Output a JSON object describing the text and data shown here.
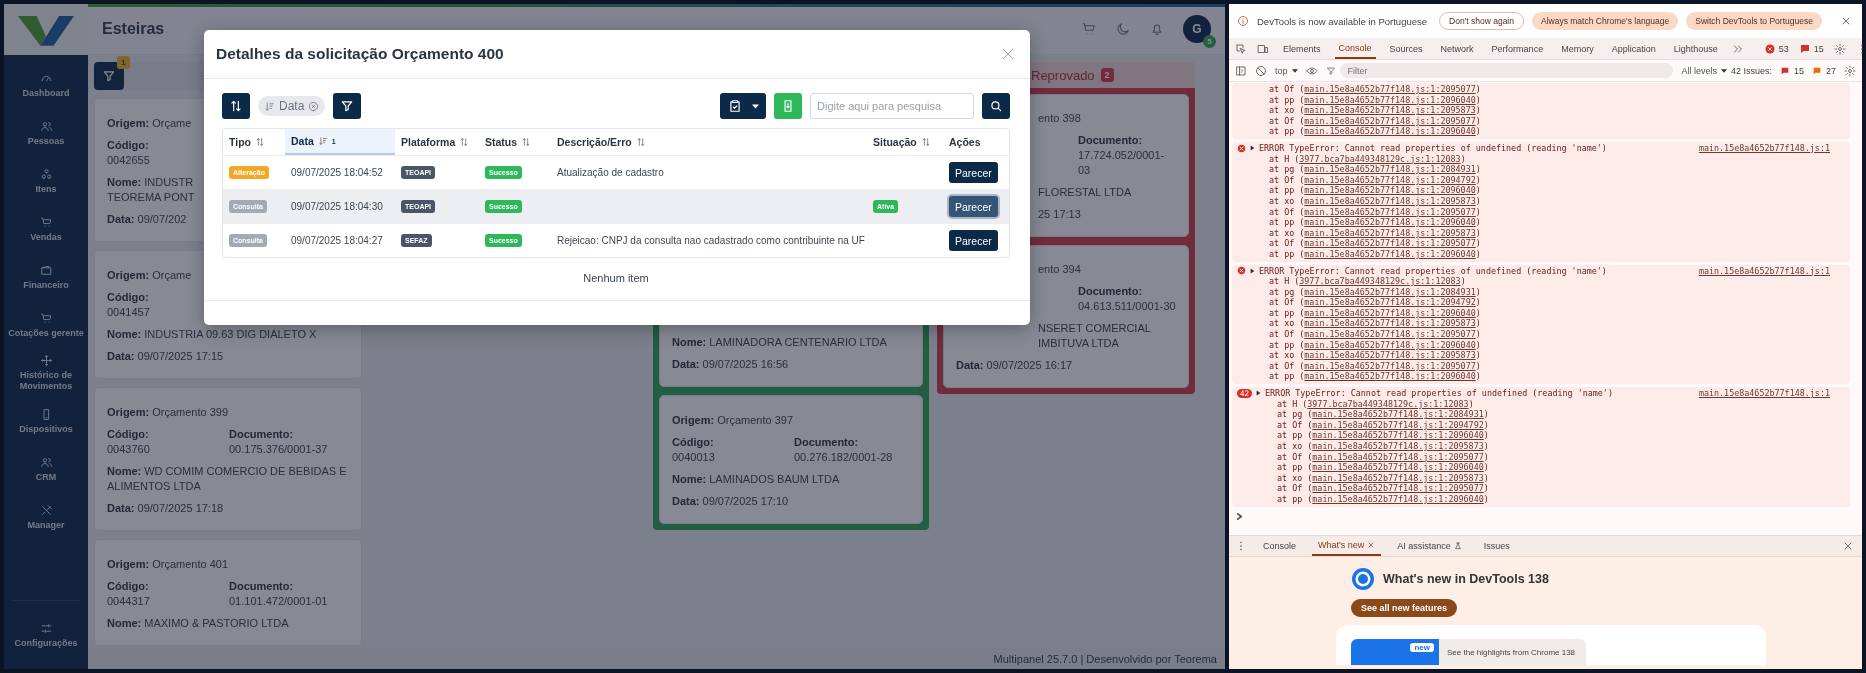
{
  "app": {
    "header": {
      "title": "Esteiras",
      "avatar_initial": "G",
      "avatar_badge": "5"
    },
    "sidebar": {
      "items": [
        {
          "label": "Dashboard",
          "kind": "gauge"
        },
        {
          "label": "Pessoas",
          "kind": "people"
        },
        {
          "label": "Itens",
          "kind": "circles"
        },
        {
          "label": "Vendas",
          "kind": "cart"
        },
        {
          "label": "Financeiro",
          "kind": "wallet"
        },
        {
          "label": "Cotações gerente",
          "kind": "cart"
        },
        {
          "label": "Histórico de Movimentos",
          "kind": "move"
        },
        {
          "label": "Dispositivos",
          "kind": "phone"
        },
        {
          "label": "CRM",
          "kind": "people"
        },
        {
          "label": "Manager",
          "kind": "tools"
        }
      ],
      "footer_item": {
        "label": "Configurações",
        "kind": "sliders"
      }
    },
    "board": {
      "filter_badge": "1",
      "first_column_cards": [
        {
          "origem": {
            "label": "Origem:",
            "value": "Orçame"
          },
          "codigo": {
            "label": "Código:",
            "value": "0042655"
          },
          "nome": {
            "label": "Nome:",
            "value": "INDUSTR\nTEOREMA PONT"
          },
          "data": {
            "label": "Data:",
            "value": "09/07/202"
          }
        },
        {
          "origem": {
            "label": "Origem:",
            "value": "Orçame"
          },
          "codigo": {
            "label": "Código:",
            "value": "0041457"
          },
          "nome": {
            "label": "Nome:",
            "value": "INDUSTRIA 09.63 DIG DIALETO X"
          },
          "data": {
            "label": "Data:",
            "value": "09/07/2025 17:15"
          }
        },
        {
          "origem": {
            "label": "Origem:",
            "value": "Orçamento 399"
          },
          "codigo": {
            "label": "Código:",
            "value": "0043760"
          },
          "documento": {
            "label": "Documento:",
            "value": "00.175.376/0001-37"
          },
          "nome": {
            "label": "Nome:",
            "value": "WD COMIM COMERCIO DE BEBIDAS E ALIMENTOS LTDA"
          },
          "data": {
            "label": "Data:",
            "value": "09/07/2025 17:18"
          }
        },
        {
          "origem": {
            "label": "Origem:",
            "value": "Orçamento 401"
          },
          "codigo": {
            "label": "Código:",
            "value": "0044317"
          },
          "documento": {
            "label": "Documento:",
            "value": "01.101.472/0001-01"
          },
          "nome": {
            "label": "Nome:",
            "value": "MAXIMO & PASTORIO LTDA"
          }
        }
      ],
      "approved_cards": [
        {
          "nome": {
            "label": "Nome:",
            "value": "LAMINADORA CENTENARIO LTDA"
          },
          "data": {
            "label": "Data:",
            "value": "09/07/2025 16:56"
          }
        },
        {
          "origem": {
            "label": "Origem:",
            "value": "Orçamento 397"
          },
          "codigo": {
            "label": "Código:",
            "value": "0040013"
          },
          "documento": {
            "label": "Documento:",
            "value": "00.276.182/0001-28"
          },
          "nome": {
            "label": "Nome:",
            "value": "LAMINADOS BAUM LTDA"
          },
          "data": {
            "label": "Data:",
            "value": "09/07/2025 17:10"
          }
        }
      ],
      "rejected": {
        "title": "Reprovado",
        "count": "2",
        "cards": [
          {
            "origem": {
              "value": "ento 398"
            },
            "documento": {
              "label": "Documento:",
              "value": "17.724.052/0001-03"
            },
            "nome": {
              "value": "FLORESTAL LTDA"
            },
            "data": {
              "value": "25 17:13"
            }
          },
          {
            "origem": {
              "value": "ento 394"
            },
            "documento": {
              "label": "Documento:",
              "value": "04.613.511/0001-30"
            },
            "nome": {
              "value": "NSERET COMERCIAL\nIMBITUVA LTDA"
            },
            "data": {
              "label": "Data:",
              "value": "09/07/2025 16:17"
            }
          }
        ]
      }
    },
    "footer": "Multipanel 25.7.0 | Desenvolvido por Teorema"
  },
  "modal": {
    "title": "Detalhes da solicitação Orçamento 400",
    "sort_chip": "Data",
    "search": {
      "placeholder": "Digite aqui para pesquisa"
    },
    "table": {
      "columns": [
        {
          "label": "Tipo",
          "sortable": true,
          "sorted": false
        },
        {
          "label": "Data",
          "sortable": true,
          "sorted": true,
          "sort_index": "1"
        },
        {
          "label": "Plataforma",
          "sortable": true,
          "sorted": false
        },
        {
          "label": "Status",
          "sortable": true,
          "sorted": false
        },
        {
          "label": "Descrição/Erro",
          "sortable": true,
          "sorted": false
        },
        {
          "label": "Situação",
          "sortable": true,
          "sorted": false
        },
        {
          "label": "Ações",
          "sortable": false,
          "sorted": false
        }
      ],
      "rows": [
        {
          "tipo": "Alteração",
          "color": "#f5a623",
          "data": "09/07/2025 18:04:52",
          "plataforma": "TEOAPI",
          "status": "Sucesso",
          "descricao": "Atualização de cadastro",
          "action": "Parecer",
          "selected": false
        },
        {
          "tipo": "Consulta",
          "color": "#a3aab6",
          "data": "09/07/2025 18:04:30",
          "plataforma": "TEOAPI",
          "status": "Sucesso",
          "situacao": "Ativa",
          "action": "Parecer",
          "selected": true
        },
        {
          "tipo": "Consulta",
          "color": "#a3aab6",
          "data": "09/07/2025 18:04:27",
          "plataforma": "SEFAZ",
          "status": "Sucesso",
          "descricao": "Rejeicao: CNPJ da consulta nao cadastrado como contribuinte na UF",
          "action": "Parecer",
          "selected": false
        }
      ],
      "empty_text": "Nenhum item"
    }
  },
  "devtools": {
    "infobar": {
      "message": "DevTools is now available in Portuguese",
      "buttons": [
        {
          "label": "Don't show again",
          "kind": "outline"
        },
        {
          "label": "Always match Chrome's language",
          "kind": "filled"
        },
        {
          "label": "Switch DevTools to Portuguese",
          "kind": "filled"
        }
      ]
    },
    "tabs": [
      {
        "label": "Elements",
        "selected": false
      },
      {
        "label": "Console",
        "selected": true
      },
      {
        "label": "Sources",
        "selected": false
      },
      {
        "label": "Network",
        "selected": false
      },
      {
        "label": "Performance",
        "selected": false
      },
      {
        "label": "Memory",
        "selected": false
      },
      {
        "label": "Application",
        "selected": false
      },
      {
        "label": "Lighthouse",
        "selected": false
      }
    ],
    "error_count": "53",
    "issue_count": "15",
    "console_toolbar": {
      "context": "top",
      "filter_placeholder": "Filter",
      "levels": "All levels",
      "issues_label": "42 Issues:",
      "issues_errors": "15",
      "issues_warnings": "27"
    },
    "messages": [
      {
        "kind": "continuation",
        "frames": [
          {
            "call": "at Of (",
            "link": "main.15e8a4652b77f148.js:1:2095077",
            "close": ")"
          },
          {
            "call": "at pp (",
            "link": "main.15e8a4652b77f148.js:1:2096040",
            "close": ")"
          },
          {
            "call": "at xo (",
            "link": "main.15e8a4652b77f148.js:1:2095873",
            "close": ")"
          },
          {
            "call": "at Of (",
            "link": "main.15e8a4652b77f148.js:1:2095077",
            "close": ")"
          },
          {
            "call": "at pp (",
            "link": "main.15e8a4652b77f148.js:1:2096040",
            "close": ")"
          }
        ]
      },
      {
        "kind": "error",
        "text": "ERROR TypeError: Cannot read properties of undefined (reading 'name')",
        "source": "main.15e8a4652b77f148.js:1",
        "frames": [
          {
            "call": "at H (",
            "link": "3977.bca7ba449348129c.js:1:12083",
            "close": ")"
          },
          {
            "call": "at pg (",
            "link": "main.15e8a4652b77f148.js:1:2084931",
            "close": ")"
          },
          {
            "call": "at Of (",
            "link": "main.15e8a4652b77f148.js:1:2094792",
            "close": ")"
          },
          {
            "call": "at pp (",
            "link": "main.15e8a4652b77f148.js:1:2096040",
            "close": ")"
          },
          {
            "call": "at xo (",
            "link": "main.15e8a4652b77f148.js:1:2095873",
            "close": ")"
          },
          {
            "call": "at Of (",
            "link": "main.15e8a4652b77f148.js:1:2095077",
            "close": ")"
          },
          {
            "call": "at pp (",
            "link": "main.15e8a4652b77f148.js:1:2096040",
            "close": ")"
          },
          {
            "call": "at xo (",
            "link": "main.15e8a4652b77f148.js:1:2095873",
            "close": ")"
          },
          {
            "call": "at Of (",
            "link": "main.15e8a4652b77f148.js:1:2095077",
            "close": ")"
          },
          {
            "call": "at pp (",
            "link": "main.15e8a4652b77f148.js:1:2096040",
            "close": ")"
          }
        ]
      },
      {
        "kind": "error",
        "text": "ERROR TypeError: Cannot read properties of undefined (reading 'name')",
        "source": "main.15e8a4652b77f148.js:1",
        "frames": [
          {
            "call": "at H (",
            "link": "3977.bca7ba449348129c.js:1:12083",
            "close": ")"
          },
          {
            "call": "at pg (",
            "link": "main.15e8a4652b77f148.js:1:2084931",
            "close": ")"
          },
          {
            "call": "at Of (",
            "link": "main.15e8a4652b77f148.js:1:2094792",
            "close": ")"
          },
          {
            "call": "at pp (",
            "link": "main.15e8a4652b77f148.js:1:2096040",
            "close": ")"
          },
          {
            "call": "at xo (",
            "link": "main.15e8a4652b77f148.js:1:2095873",
            "close": ")"
          },
          {
            "call": "at Of (",
            "link": "main.15e8a4652b77f148.js:1:2095077",
            "close": ")"
          },
          {
            "call": "at pp (",
            "link": "main.15e8a4652b77f148.js:1:2096040",
            "close": ")"
          },
          {
            "call": "at xo (",
            "link": "main.15e8a4652b77f148.js:1:2095873",
            "close": ")"
          },
          {
            "call": "at Of (",
            "link": "main.15e8a4652b77f148.js:1:2095077",
            "close": ")"
          },
          {
            "call": "at pp (",
            "link": "main.15e8a4652b77f148.js:1:2096040",
            "close": ")"
          }
        ]
      },
      {
        "kind": "error",
        "count": "42",
        "text": "ERROR TypeError: Cannot read properties of undefined (reading 'name')",
        "source": "main.15e8a4652b77f148.js:1",
        "frames": [
          {
            "call": "at H (",
            "link": "3977.bca7ba449348129c.js:1:12083",
            "close": ")"
          },
          {
            "call": "at pg (",
            "link": "main.15e8a4652b77f148.js:1:2084931",
            "close": ")"
          },
          {
            "call": "at Of (",
            "link": "main.15e8a4652b77f148.js:1:2094792",
            "close": ")"
          },
          {
            "call": "at pp (",
            "link": "main.15e8a4652b77f148.js:1:2096040",
            "close": ")"
          },
          {
            "call": "at xo (",
            "link": "main.15e8a4652b77f148.js:1:2095873",
            "close": ")"
          },
          {
            "call": "at Of (",
            "link": "main.15e8a4652b77f148.js:1:2095077",
            "close": ")"
          },
          {
            "call": "at pp (",
            "link": "main.15e8a4652b77f148.js:1:2096040",
            "close": ")"
          },
          {
            "call": "at xo (",
            "link": "main.15e8a4652b77f148.js:1:2095873",
            "close": ")"
          },
          {
            "call": "at Of (",
            "link": "main.15e8a4652b77f148.js:1:2095077",
            "close": ")"
          },
          {
            "call": "at pp (",
            "link": "main.15e8a4652b77f148.js:1:2096040",
            "close": ")"
          }
        ]
      }
    ],
    "drawer": {
      "tabs": [
        {
          "label": "Console",
          "selected": false,
          "closable": false,
          "experimental": false
        },
        {
          "label": "What's new",
          "selected": true,
          "closable": true,
          "experimental": false
        },
        {
          "label": "AI assistance",
          "selected": false,
          "closable": false,
          "experimental": true
        },
        {
          "label": "Issues",
          "selected": false,
          "closable": false,
          "experimental": false
        }
      ],
      "whats_new": {
        "title": "What's new in DevTools 138",
        "button": "See all new features",
        "badge": "new",
        "highlight": "See the highlights from Chrome 138"
      }
    }
  }
}
